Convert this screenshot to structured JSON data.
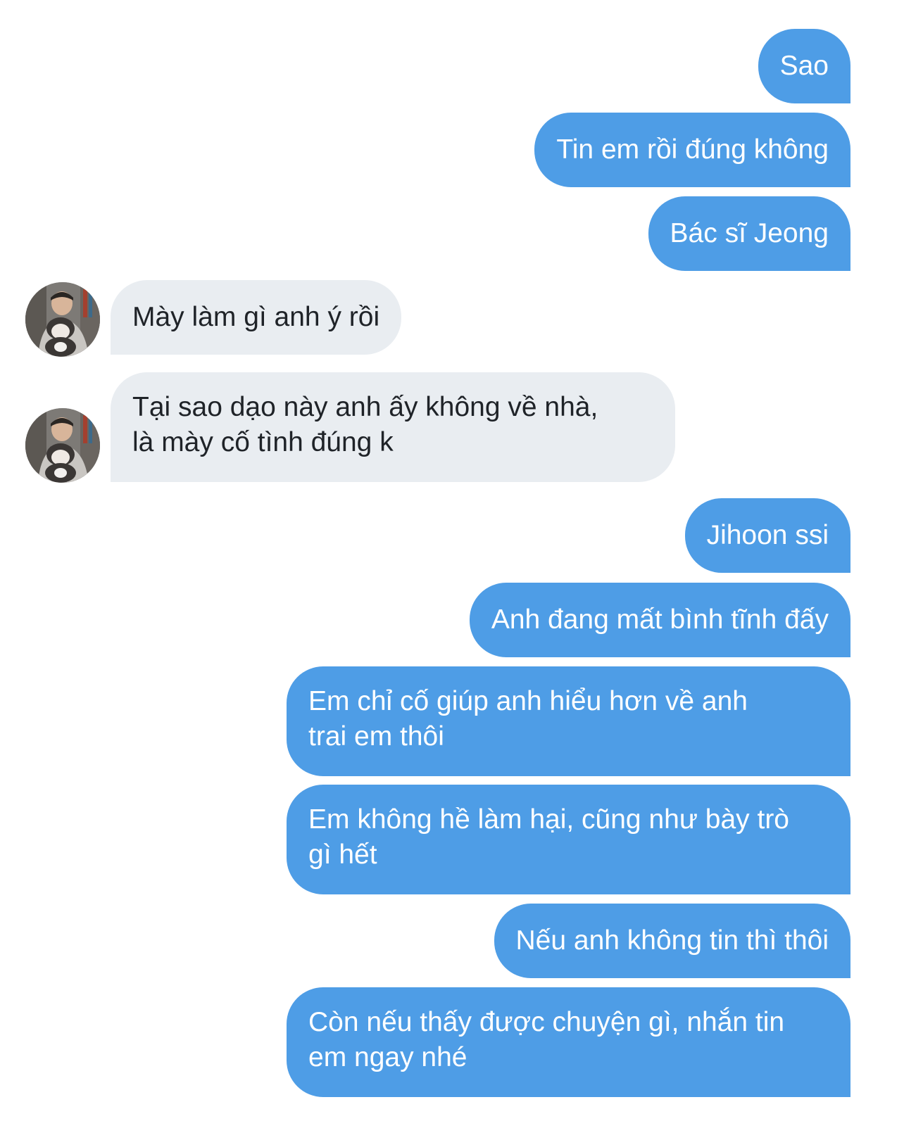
{
  "conversation": {
    "messages": [
      {
        "direction": "out",
        "text": "Sao"
      },
      {
        "direction": "out",
        "text": "Tin em rồi đúng không"
      },
      {
        "direction": "out",
        "text": "Bác sĩ Jeong"
      },
      {
        "direction": "in",
        "text": "Mày làm gì anh ý rồi"
      },
      {
        "direction": "in",
        "text": "Tại sao dạo này anh ấy không về nhà,\nlà mày cố tình đúng k"
      },
      {
        "direction": "out",
        "text": "Jihoon ssi"
      },
      {
        "direction": "out",
        "text": "Anh đang mất bình tĩnh đấy"
      },
      {
        "direction": "out",
        "text": "Em chỉ cố giúp anh hiểu hơn về anh\ntrai em thôi"
      },
      {
        "direction": "out",
        "text": "Em không hề làm hại, cũng như bày trò\ngì hết"
      },
      {
        "direction": "out",
        "text": "Nếu anh không tin thì thôi"
      },
      {
        "direction": "out",
        "text": "Còn nếu thấy được chuyện gì, nhắn tin\nem ngay nhé"
      }
    ],
    "colors": {
      "outgoing_bubble": "#4e9de6",
      "incoming_bubble": "#e9edf1",
      "outgoing_text": "#ffffff",
      "incoming_text": "#1f2328"
    },
    "avatar_icon": "contact-avatar-photo"
  }
}
